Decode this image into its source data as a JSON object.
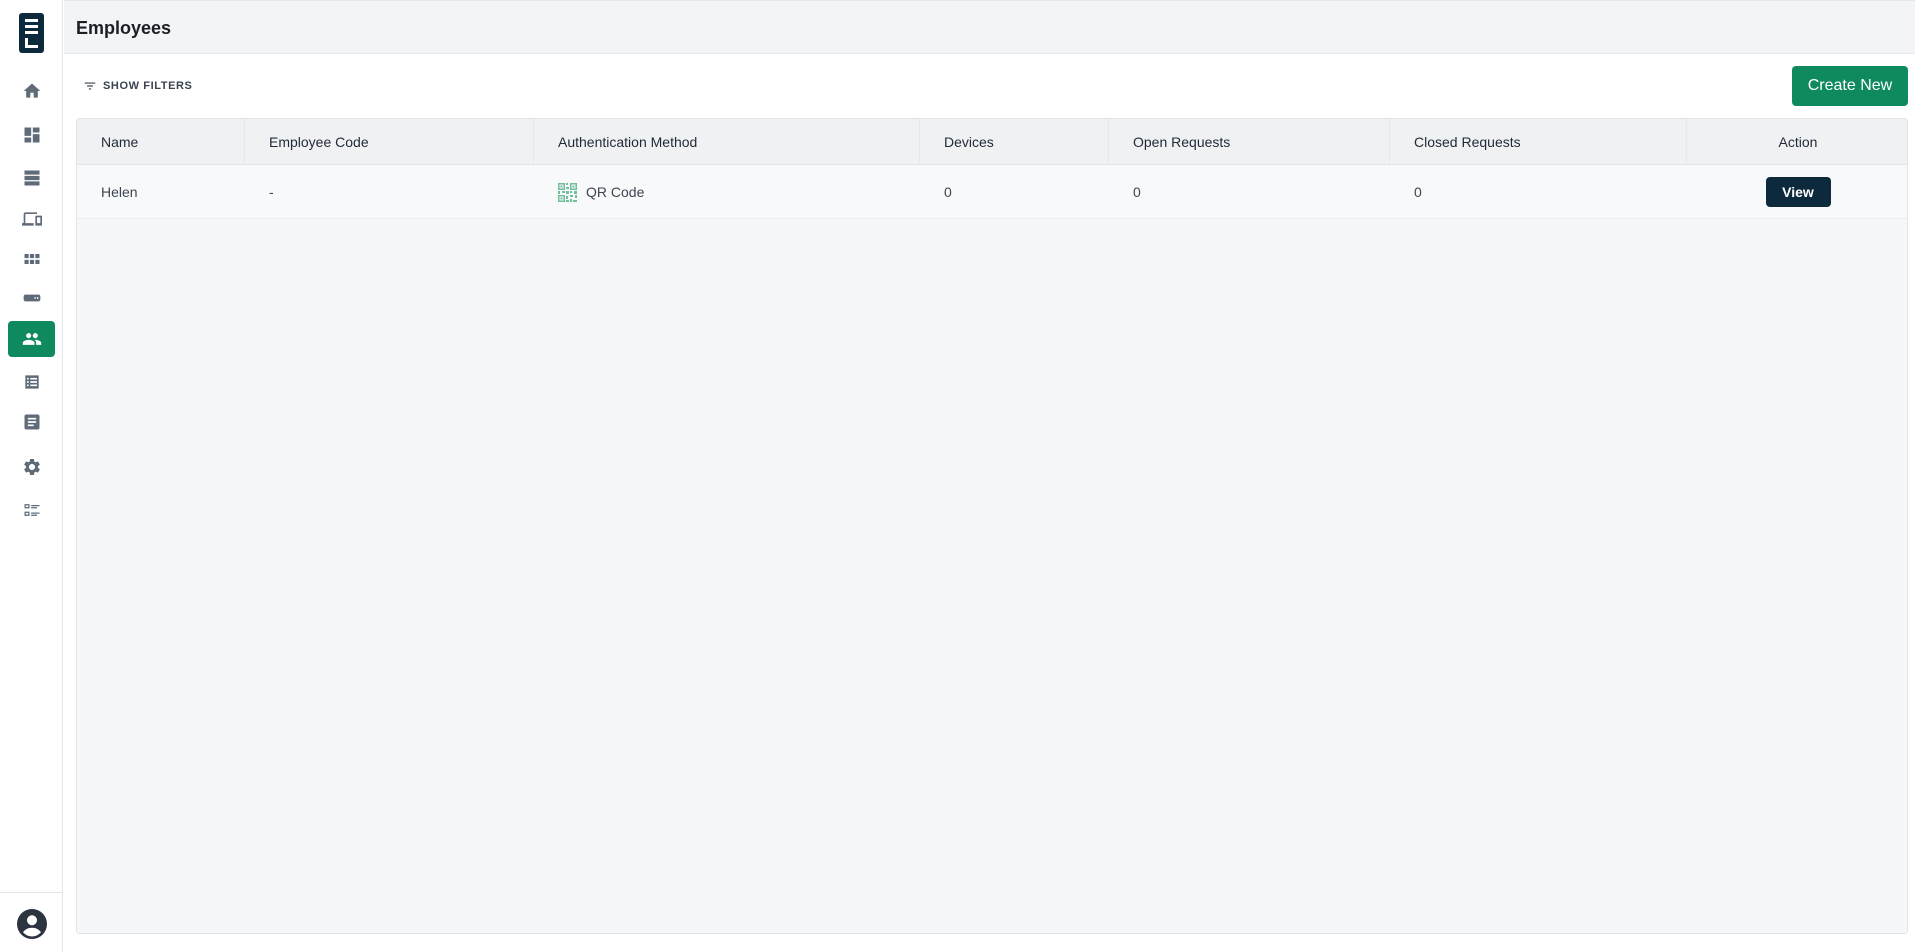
{
  "header": {
    "title": "Employees"
  },
  "toolbar": {
    "filters_label": "SHOW FILTERS",
    "create_label": "Create New"
  },
  "colors": {
    "accent": "#0f8a5f",
    "dark": "#0c2a3c"
  },
  "sidebar": {
    "items": [
      {
        "name": "home",
        "icon": "home-icon"
      },
      {
        "name": "dashboard",
        "icon": "dashboard-icon"
      },
      {
        "name": "storage",
        "icon": "storage-icon"
      },
      {
        "name": "devices",
        "icon": "devices-icon"
      },
      {
        "name": "apps",
        "icon": "apps-icon"
      },
      {
        "name": "hardware",
        "icon": "hardware-icon"
      },
      {
        "name": "employees",
        "icon": "people-icon",
        "active": true
      },
      {
        "name": "list",
        "icon": "list-icon"
      },
      {
        "name": "document",
        "icon": "document-icon"
      },
      {
        "name": "settings",
        "icon": "gear-icon"
      },
      {
        "name": "checklist",
        "icon": "checklist-icon"
      }
    ]
  },
  "table": {
    "columns": [
      "Name",
      "Employee Code",
      "Authentication Method",
      "Devices",
      "Open Requests",
      "Closed Requests",
      "Action"
    ],
    "rows": [
      {
        "name": "Helen",
        "code": "-",
        "auth_method": "QR Code",
        "auth_icon": "qr-code-icon",
        "devices": "0",
        "open_requests": "0",
        "closed_requests": "0",
        "action_label": "View"
      }
    ]
  }
}
